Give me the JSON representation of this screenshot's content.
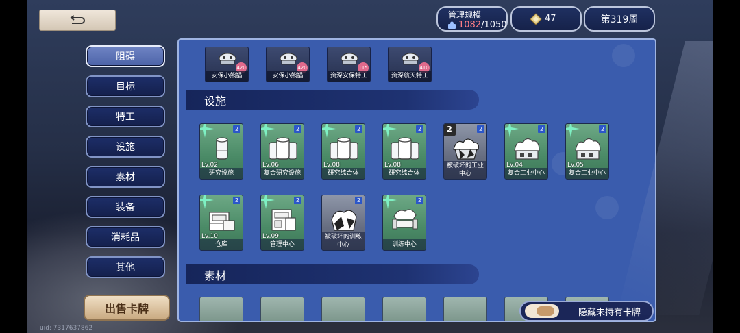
{
  "header": {
    "scale_label": "管理规模",
    "scale_current": "1082",
    "scale_separator": "/",
    "scale_max": "1050",
    "gem_count": "47",
    "week": "第319周"
  },
  "sidebar": {
    "items": [
      {
        "label": "阻碍",
        "active": true
      },
      {
        "label": "目标",
        "active": false
      },
      {
        "label": "特工",
        "active": false
      },
      {
        "label": "设施",
        "active": false
      },
      {
        "label": "素材",
        "active": false
      },
      {
        "label": "装备",
        "active": false
      },
      {
        "label": "消耗品",
        "active": false
      },
      {
        "label": "其他",
        "active": false
      }
    ],
    "sell_button": "出售卡牌"
  },
  "uid": "uid: 7317637862",
  "obstacles": [
    {
      "name": "安保小熊猫",
      "badge": "420"
    },
    {
      "name": "安保小熊猫",
      "badge": "420"
    },
    {
      "name": "资深安保特工",
      "badge": "115"
    },
    {
      "name": "资深航天特工",
      "badge": "410"
    }
  ],
  "sections": {
    "facilities_title": "设施",
    "materials_title": "素材"
  },
  "facilities": [
    {
      "level": "Lv.02",
      "name": "研究设施",
      "num": "2",
      "style": "green",
      "icon": "research-facility-icon"
    },
    {
      "level": "Lv.06",
      "name": "复合研究设施",
      "num": "2",
      "style": "green",
      "icon": "research-complex-icon"
    },
    {
      "level": "Lv.08",
      "name": "研究综合体",
      "num": "2",
      "style": "green",
      "icon": "research-complex-icon"
    },
    {
      "level": "Lv.08",
      "name": "研究综合体",
      "num": "2",
      "style": "green",
      "icon": "research-complex-icon"
    },
    {
      "level": "",
      "name": "被破坏的工业中心",
      "num": "2",
      "count": "2",
      "style": "dark",
      "icon": "destroyed-factory-icon"
    },
    {
      "level": "Lv.04",
      "name": "复合工业中心",
      "num": "2",
      "style": "green",
      "icon": "factory-icon"
    },
    {
      "level": "Lv.05",
      "name": "复合工业中心",
      "num": "2",
      "style": "green",
      "icon": "factory-icon"
    },
    {
      "level": "Lv.10",
      "name": "仓库",
      "num": "2",
      "style": "green",
      "icon": "warehouse-icon"
    },
    {
      "level": "Lv.09",
      "name": "管理中心",
      "num": "2",
      "style": "green",
      "icon": "management-icon"
    },
    {
      "level": "",
      "name": "被破坏的训练中心",
      "num": "2",
      "style": "dark",
      "icon": "destroyed-training-icon"
    },
    {
      "level": "",
      "name": "训练中心",
      "num": "2",
      "style": "green",
      "icon": "training-icon"
    }
  ],
  "toggle": {
    "label": "隐藏未持有卡牌"
  },
  "colors": {
    "panel": "#3a5cad",
    "card_green": "#4a8a66",
    "scale_current": "#ff7f87"
  }
}
